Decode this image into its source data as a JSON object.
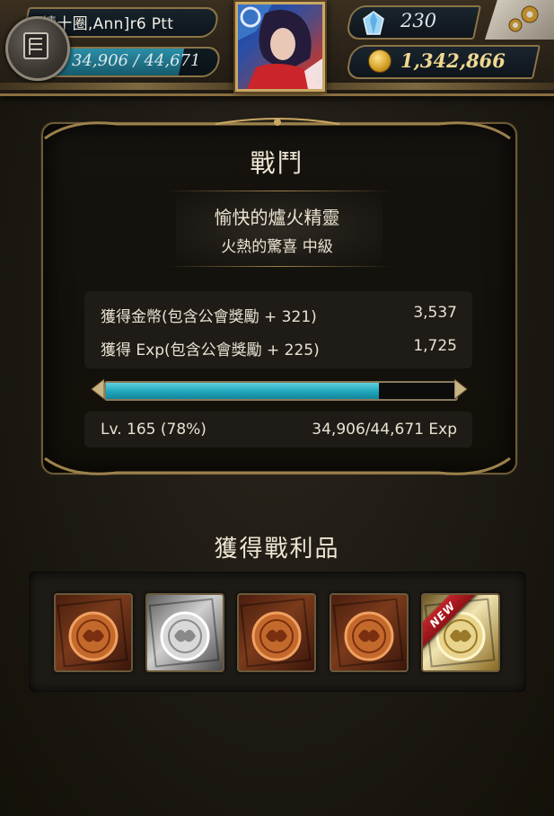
{
  "header": {
    "player_name": "績十圈,Ann]r6  Ptt",
    "exp_text": "34,906 / 44,671",
    "exp_fraction": 0.78,
    "gems": "230",
    "gold": "1,342,866",
    "menu_icon": "menu-book-icon",
    "settings_icon": "gear-icon"
  },
  "battle": {
    "title": "戰鬥",
    "enemy_name": "愉快的爐火精靈",
    "difficulty": "火熱的驚喜 中級",
    "gold_label": "獲得金幣(包含公會獎勵 + 321)",
    "gold_value": "3,537",
    "exp_label": "獲得 Exp(包含公會獎勵 + 225)",
    "exp_value": "1,725",
    "level_text": "Lv. 165 (78%)",
    "level_exp_text": "34,906/44,671 Exp",
    "progress_fraction": 0.78
  },
  "loot": {
    "title": "獲得戰利品",
    "items": [
      {
        "kind": "bronze",
        "badge": ""
      },
      {
        "kind": "silver",
        "badge": ""
      },
      {
        "kind": "bronze",
        "badge": ""
      },
      {
        "kind": "bronze",
        "badge": ""
      },
      {
        "kind": "gold",
        "badge": "NEW"
      }
    ]
  },
  "colors": {
    "accent_cyan": "#1fa5bc",
    "frame_gold": "#c9a864",
    "new_badge": "#c2242a"
  }
}
